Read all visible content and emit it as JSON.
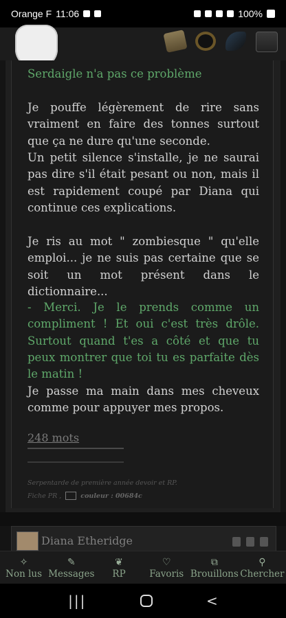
{
  "status": {
    "carrier": "Orange F",
    "time": "11:06",
    "battery": "100%"
  },
  "post": {
    "p1": "Serdaigle n'a pas ce problème",
    "p2": "Je pouffe légèrement de rire sans vraiment en faire des tonnes surtout que ça ne dure qu'une seconde.",
    "p3": "Un petit silence s'installe, je ne saurai pas dire s'il était pesant ou non, mais il est rapidement coupé par Diana qui continue ces explications.",
    "p4": "Je ris au mot \" zombiesque \" qu'elle emploi... je ne suis pas certaine que se soit un mot présent dans le dictionnaire...",
    "p5": "- Merci. Je le prends comme un compliment ! Et oui c'est très drôle. Surtout quand t'es a côté et que tu peux montrer que toi tu es parfaite dès le matin !",
    "p6": "Je passe ma main dans mes cheveux comme pour appuyer mes propos.",
    "words": "248 mots",
    "signature": "Serpentarde de première année devoir et RP.",
    "fiche": "Fiche PR ,",
    "couleur": "couleur : 00684c"
  },
  "next_post": {
    "author": "Diana Etheridge"
  },
  "bottom_nav": [
    {
      "label": "Non lus",
      "icon": "sparkle-icon"
    },
    {
      "label": "Messages",
      "icon": "pen-icon"
    },
    {
      "label": "RP",
      "icon": "feather-icon"
    },
    {
      "label": "Favoris",
      "icon": "heart-icon"
    },
    {
      "label": "Brouillons",
      "icon": "drafts-icon"
    },
    {
      "label": "Chercher",
      "icon": "search-icon"
    }
  ],
  "colors": {
    "green_text": "#5fa86a",
    "body_text": "#d2d2d2",
    "background": "#1b1b1b"
  }
}
